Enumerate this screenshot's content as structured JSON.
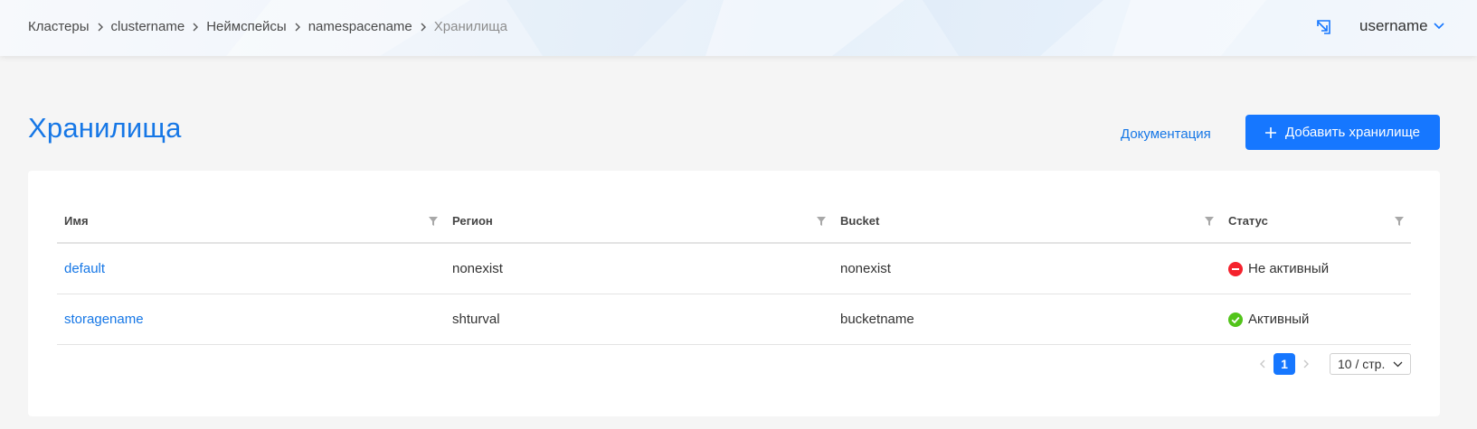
{
  "header": {
    "breadcrumbs": [
      "Кластеры",
      "clustername",
      "Неймспейсы",
      "namespacename",
      "Хранилища"
    ],
    "username": "username"
  },
  "page": {
    "title": "Хранилища",
    "doc_link": "Документация",
    "add_button": "Добавить хранилище"
  },
  "table": {
    "columns": [
      "Имя",
      "Регион",
      "Bucket",
      "Статус"
    ],
    "rows": [
      {
        "name": "default",
        "region": "nonexist",
        "bucket": "nonexist",
        "status": "Не активный",
        "status_icon": "minus-circle-icon",
        "status_color": "#f5222d"
      },
      {
        "name": "storagename",
        "region": "shturval",
        "bucket": "bucketname",
        "status": "Активный",
        "status_icon": "check-circle-icon",
        "status_color": "#52c41a"
      }
    ]
  },
  "pagination": {
    "current_page": "1",
    "page_size": "10 / стр."
  },
  "colors": {
    "accent": "#1677ff",
    "link": "#1677e6"
  }
}
